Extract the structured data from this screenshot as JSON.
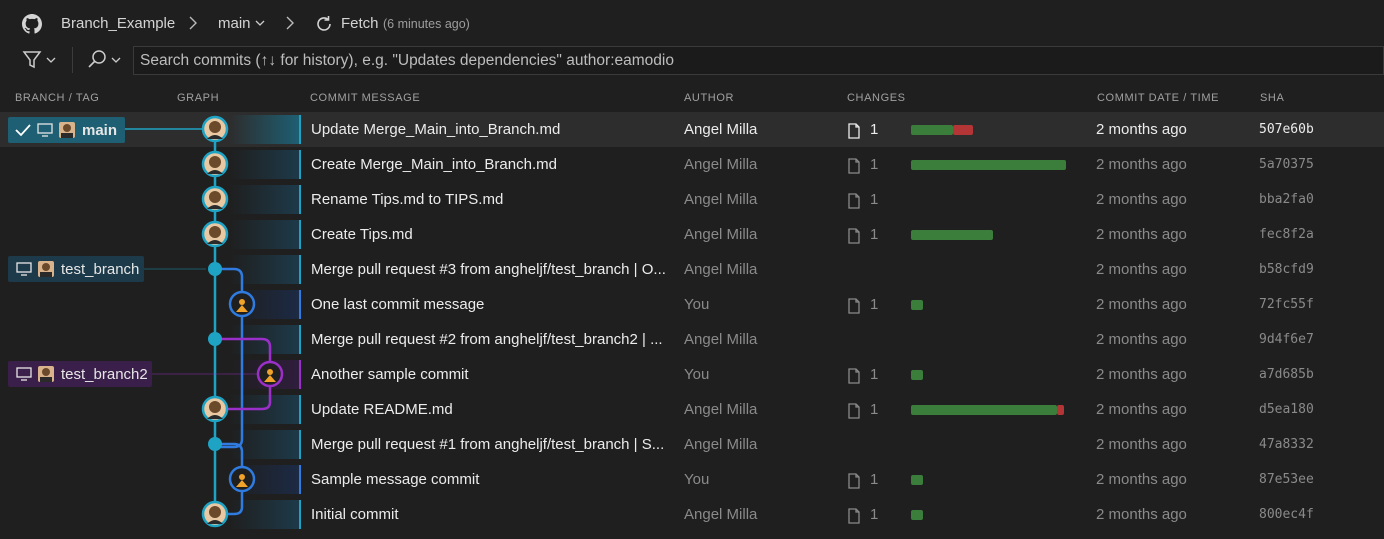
{
  "toolbar": {
    "repo_name": "Branch_Example",
    "branch_name": "main",
    "fetch_label": "Fetch",
    "fetch_time": "(6 minutes ago)"
  },
  "search": {
    "placeholder": "Search commits (↑↓ for history), e.g. \"Updates dependencies\" author:eamodio"
  },
  "columns": {
    "branch_tag": "BRANCH / TAG",
    "graph": "GRAPH",
    "commit_message": "COMMIT MESSAGE",
    "author": "AUTHOR",
    "changes": "CHANGES",
    "commit_date": "COMMIT DATE / TIME",
    "sha": "SHA"
  },
  "branch_labels": {
    "main": "main",
    "test_branch": "test_branch",
    "test_branch2": "test_branch2"
  },
  "colors": {
    "main_lane": "#1fa3c4",
    "blue_lane": "#2f7be0",
    "purple_lane": "#9b2fc9",
    "additions": "#3b7d3b",
    "deletions": "#b33535"
  },
  "commits": [
    {
      "message": "Update Merge_Main_into_Branch.md",
      "author": "Angel Milla",
      "files": "1",
      "adds_fraction": 0.27,
      "dels_fraction": 0.13,
      "date": "2 months ago",
      "sha": "507e60b"
    },
    {
      "message": "Create Merge_Main_into_Branch.md",
      "author": "Angel Milla",
      "files": "1",
      "adds_fraction": 1.0,
      "dels_fraction": 0,
      "date": "2 months ago",
      "sha": "5a70375"
    },
    {
      "message": "Rename Tips.md to TIPS.md",
      "author": "Angel Milla",
      "files": "1",
      "adds_fraction": 0,
      "dels_fraction": 0,
      "date": "2 months ago",
      "sha": "bba2fa0"
    },
    {
      "message": "Create Tips.md",
      "author": "Angel Milla",
      "files": "1",
      "adds_fraction": 0.53,
      "dels_fraction": 0,
      "date": "2 months ago",
      "sha": "fec8f2a"
    },
    {
      "message": "Merge pull request #3 from angheljf/test_branch | O...",
      "author": "Angel Milla",
      "files": "",
      "adds_fraction": 0,
      "dels_fraction": 0,
      "date": "2 months ago",
      "sha": "b58cfd9"
    },
    {
      "message": "One last commit message",
      "author": "You",
      "files": "1",
      "adds_fraction": 0.08,
      "dels_fraction": 0,
      "date": "2 months ago",
      "sha": "72fc55f"
    },
    {
      "message": "Merge pull request #2 from angheljf/test_branch2 | ...",
      "author": "Angel Milla",
      "files": "",
      "adds_fraction": 0,
      "dels_fraction": 0,
      "date": "2 months ago",
      "sha": "9d4f6e7"
    },
    {
      "message": "Another sample commit",
      "author": "You",
      "files": "1",
      "adds_fraction": 0.08,
      "dels_fraction": 0,
      "date": "2 months ago",
      "sha": "a7d685b"
    },
    {
      "message": "Update README.md",
      "author": "Angel Milla",
      "files": "1",
      "adds_fraction": 0.94,
      "dels_fraction": 0.05,
      "date": "2 months ago",
      "sha": "d5ea180"
    },
    {
      "message": "Merge pull request #1 from angheljf/test_branch | S...",
      "author": "Angel Milla",
      "files": "",
      "adds_fraction": 0,
      "dels_fraction": 0,
      "date": "2 months ago",
      "sha": "47a8332"
    },
    {
      "message": "Sample message commit",
      "author": "You",
      "files": "1",
      "adds_fraction": 0.08,
      "dels_fraction": 0,
      "date": "2 months ago",
      "sha": "87e53ee"
    },
    {
      "message": "Initial commit",
      "author": "Angel Milla",
      "files": "1",
      "adds_fraction": 0.08,
      "dels_fraction": 0,
      "date": "2 months ago",
      "sha": "800ec4f"
    }
  ]
}
